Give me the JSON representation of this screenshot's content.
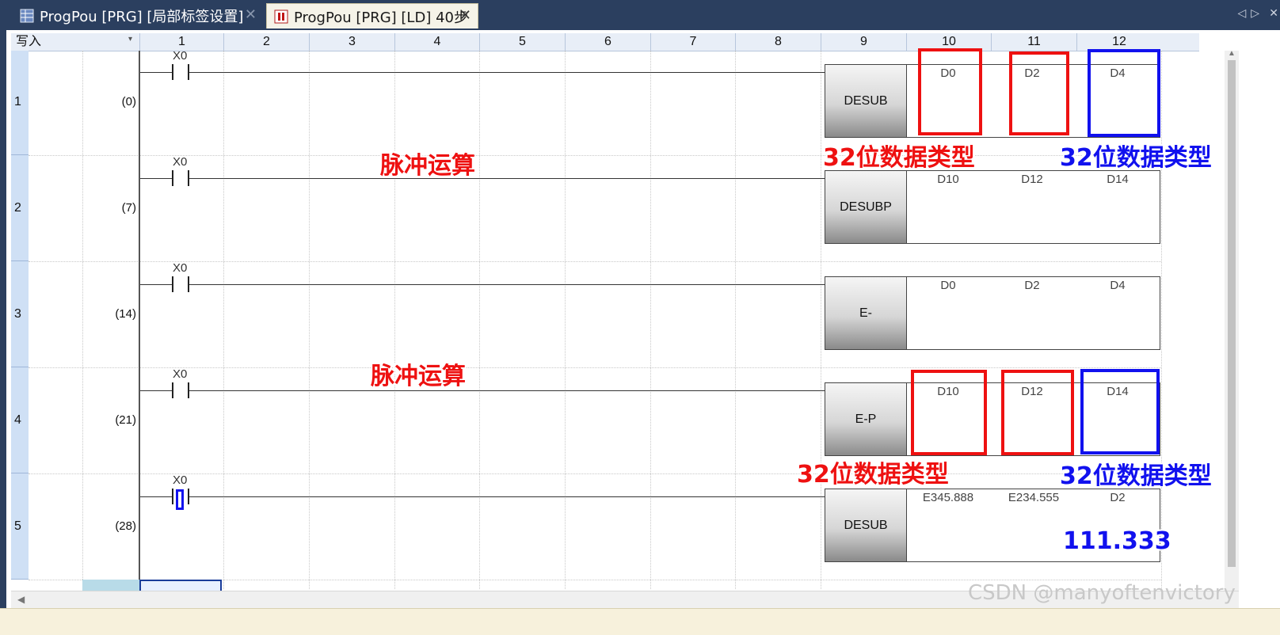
{
  "tabs": [
    {
      "label": "ProgPou [PRG] [局部标签设置]",
      "icon": "table-icon"
    },
    {
      "label": "ProgPou [PRG] [LD] 40步",
      "icon": "ladder-icon"
    }
  ],
  "tab_close_glyph": "✕",
  "nav": {
    "prev": "◁",
    "next": "▷",
    "close": "✕"
  },
  "header": {
    "mode_label": "写入",
    "mode_arrow": "▾",
    "columns": [
      "1",
      "2",
      "3",
      "4",
      "5",
      "6",
      "7",
      "8",
      "9",
      "10",
      "11",
      "12"
    ]
  },
  "rungs": [
    {
      "row": "1",
      "step": "(0)",
      "contact": "X0",
      "instruction": "DESUB",
      "operands": [
        "D0",
        "D2",
        "D4"
      ]
    },
    {
      "row": "2",
      "step": "(7)",
      "contact": "X0",
      "instruction": "DESUBP",
      "operands": [
        "D10",
        "D12",
        "D14"
      ]
    },
    {
      "row": "3",
      "step": "(14)",
      "contact": "X0",
      "instruction": "E-",
      "operands": [
        "D0",
        "D2",
        "D4"
      ]
    },
    {
      "row": "4",
      "step": "(21)",
      "contact": "X0",
      "instruction": "E-P",
      "operands": [
        "D10",
        "D12",
        "D14"
      ]
    },
    {
      "row": "5",
      "step": "(28)",
      "contact": "X0",
      "instruction": "DESUB",
      "operands": [
        "E345.888",
        "E234.555",
        "D2"
      ]
    }
  ],
  "annotations": {
    "pulse_1": "脉冲运算",
    "pulse_2": "脉冲运算",
    "type_red_1": "32位数据类型",
    "type_blue_1": "32位数据类型",
    "type_red_2": "32位数据类型",
    "type_blue_2": "32位数据类型",
    "result_value": "111.333"
  },
  "watermark": "CSDN @manyoftenvictory",
  "scroll": {
    "left_arrow": "◀",
    "up_arrow": "▲"
  },
  "colors": {
    "tabbar": "#2b3f5f",
    "annotation_red": "#ee1111",
    "annotation_blue": "#1111ee",
    "row_header": "#cfe0f5"
  }
}
